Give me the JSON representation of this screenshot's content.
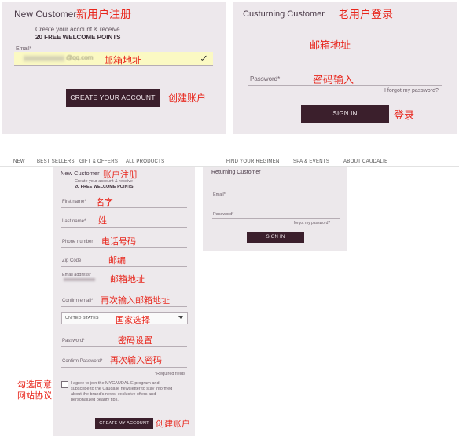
{
  "top_new": {
    "title": "New Customer",
    "anno_title": "新用户注册",
    "subtitle": "Create your account & receive",
    "points": "20 FREE WELCOME POINTS",
    "email_label": "Email*",
    "email_value": "@qq.com",
    "anno_email": "邮箱地址",
    "button": "CREATE YOUR ACCOUNT",
    "anno_button": "创建账户"
  },
  "top_returning": {
    "title": "Custurning Customer",
    "anno_title": "老用户登录",
    "anno_email": "邮箱地址",
    "password_label": "Password*",
    "anno_password": "密码输入",
    "forgot": "I forgot my password?",
    "button": "SIGN IN",
    "anno_button": "登录"
  },
  "nav": {
    "items": [
      "NEW",
      "BEST SELLERS",
      "GIFT & OFFERS",
      "ALL PRODUCTS",
      "FIND YOUR REGIMEN",
      "SPA & EVENTS",
      "ABOUT CAUDALIE"
    ]
  },
  "register": {
    "title": "New Customer",
    "anno_title": "账户注册",
    "subtitle": "Create your account & receive",
    "points": "20 FREE WELCOME POINTS",
    "first_name": "First name*",
    "anno_first_name": "名字",
    "last_name": "Last name*",
    "anno_last_name": "姓",
    "phone": "Phone number",
    "anno_phone": "电话号码",
    "zip": "Zip Code",
    "anno_zip": "邮编",
    "email": "Email address*",
    "anno_email": "邮箱地址",
    "confirm_email": "Confirm email*",
    "anno_confirm_email": "再次输入邮箱地址",
    "country": "UNITED STATES",
    "anno_country": "国家选择",
    "password": "Password*",
    "anno_password": "密码设置",
    "confirm_password": "Confirm Password*",
    "anno_confirm_password": "再次输入密码",
    "required": "*Required fields",
    "agree_line1": "I agree to join the MYCAUDALIE program and",
    "agree_line2": "subscribe to the Caudalie newsletter to stay informed",
    "agree_line3": "about the brand's news, exclusive offers and",
    "agree_line4": "personalized beauty tips.",
    "anno_agree_line1": "勾选同意",
    "anno_agree_line2": "网站协议",
    "button": "CREATE MY ACCOUNT",
    "anno_button": "创建账户"
  },
  "returning": {
    "title": "Returning Customer",
    "email": "Email*",
    "password": "Password*",
    "forgot": "I forgot my password?",
    "button": "SIGN IN"
  },
  "icons": {
    "check": "checkmark-icon",
    "dropdown": "chevron-down-icon"
  }
}
